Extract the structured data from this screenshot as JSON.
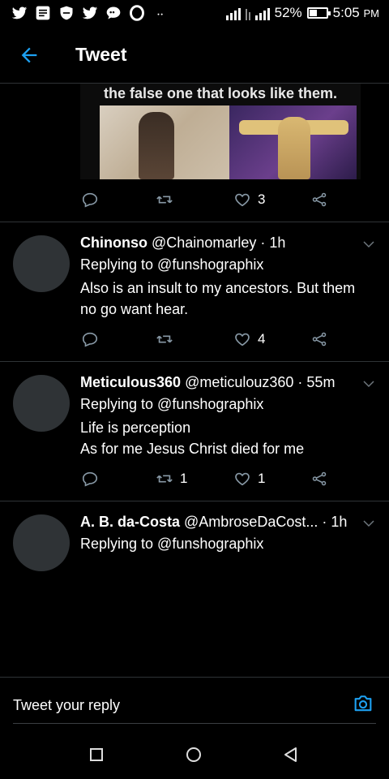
{
  "status": {
    "battery": "52%",
    "time": "5:05",
    "ampm": "PM",
    "battery_level": 0.52
  },
  "header": {
    "title": "Tweet"
  },
  "top_tweet": {
    "image_caption": "the false one that looks like them.",
    "like_count": "3"
  },
  "replies": [
    {
      "name": "Chinonso",
      "handle": "@Chainomarley",
      "time": "· 1h",
      "replying": "Replying to @funshographix",
      "lines": [
        "Also is an insult to my ancestors. But them",
        "no go want hear."
      ],
      "retweets": "",
      "likes": "4"
    },
    {
      "name": "Meticulous360",
      "handle": "@meticulouz360",
      "time": "· 55m",
      "replying": "Replying to @funshographix",
      "lines": [
        "Life is perception",
        "As for me Jesus Christ died for me"
      ],
      "retweets": "1",
      "likes": "1"
    },
    {
      "name": "A. B. da-Costa",
      "handle": "@AmbroseDaCost...",
      "time": "· 1h",
      "replying": "Replying to @funshographix",
      "lines": [],
      "retweets": "",
      "likes": ""
    }
  ],
  "composer": {
    "placeholder": "Tweet your reply"
  },
  "colors": {
    "accent": "#1da1f2",
    "background": "#000000",
    "divider": "#2f3336"
  }
}
